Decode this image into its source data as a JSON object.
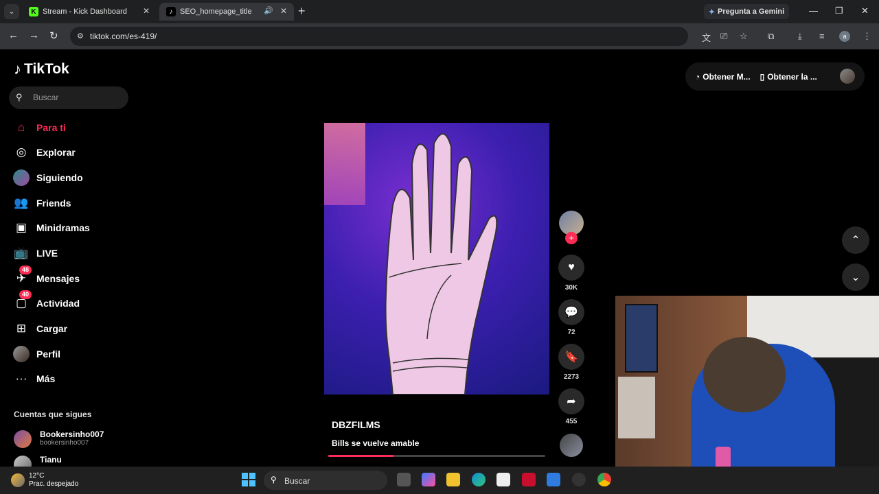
{
  "browser": {
    "tabs": [
      {
        "title": "Stream - Kick Dashboard",
        "favicon": "K"
      },
      {
        "title": "SEO_homepage_title",
        "favicon": "♪"
      }
    ],
    "gemini_label": "Pregunta a Gemini",
    "url": "tiktok.com/es-419/",
    "profile_initial": "a"
  },
  "tiktok": {
    "logo": "TikTok",
    "search_placeholder": "Buscar",
    "nav": [
      {
        "label": "Para ti",
        "icon": "home-icon"
      },
      {
        "label": "Explorar",
        "icon": "compass-icon"
      },
      {
        "label": "Siguiendo",
        "icon": "following-avatar"
      },
      {
        "label": "Friends",
        "icon": "friends-icon"
      },
      {
        "label": "Minidramas",
        "icon": "minidramas-icon"
      },
      {
        "label": "LIVE",
        "icon": "live-icon"
      },
      {
        "label": "Mensajes",
        "icon": "messages-icon",
        "badge": "48"
      },
      {
        "label": "Actividad",
        "icon": "activity-icon",
        "badge": "40"
      },
      {
        "label": "Cargar",
        "icon": "upload-icon"
      },
      {
        "label": "Perfil",
        "icon": "profile-avatar"
      },
      {
        "label": "Más",
        "icon": "more-icon"
      }
    ],
    "following_title": "Cuentas que sigues",
    "following": [
      {
        "name": "Bookersinho007",
        "handle": "bookersinho007"
      },
      {
        "name": "Tianu",
        "handle": ""
      }
    ],
    "top_right": {
      "btn1": "Obtener M...",
      "btn2": "Obtener la ..."
    },
    "video": {
      "author": "DBZFILMS",
      "description": "Bills se vuelve amable",
      "progress": 0.3,
      "likes": "30K",
      "comments": "72",
      "saves": "2273",
      "shares": "455"
    }
  },
  "taskbar": {
    "temperature": "12°C",
    "weather": "Prac. despejado",
    "search_label": "Buscar"
  },
  "colors": {
    "accent": "#fe2c55",
    "background": "#000000",
    "kick_green": "#53fc18"
  }
}
